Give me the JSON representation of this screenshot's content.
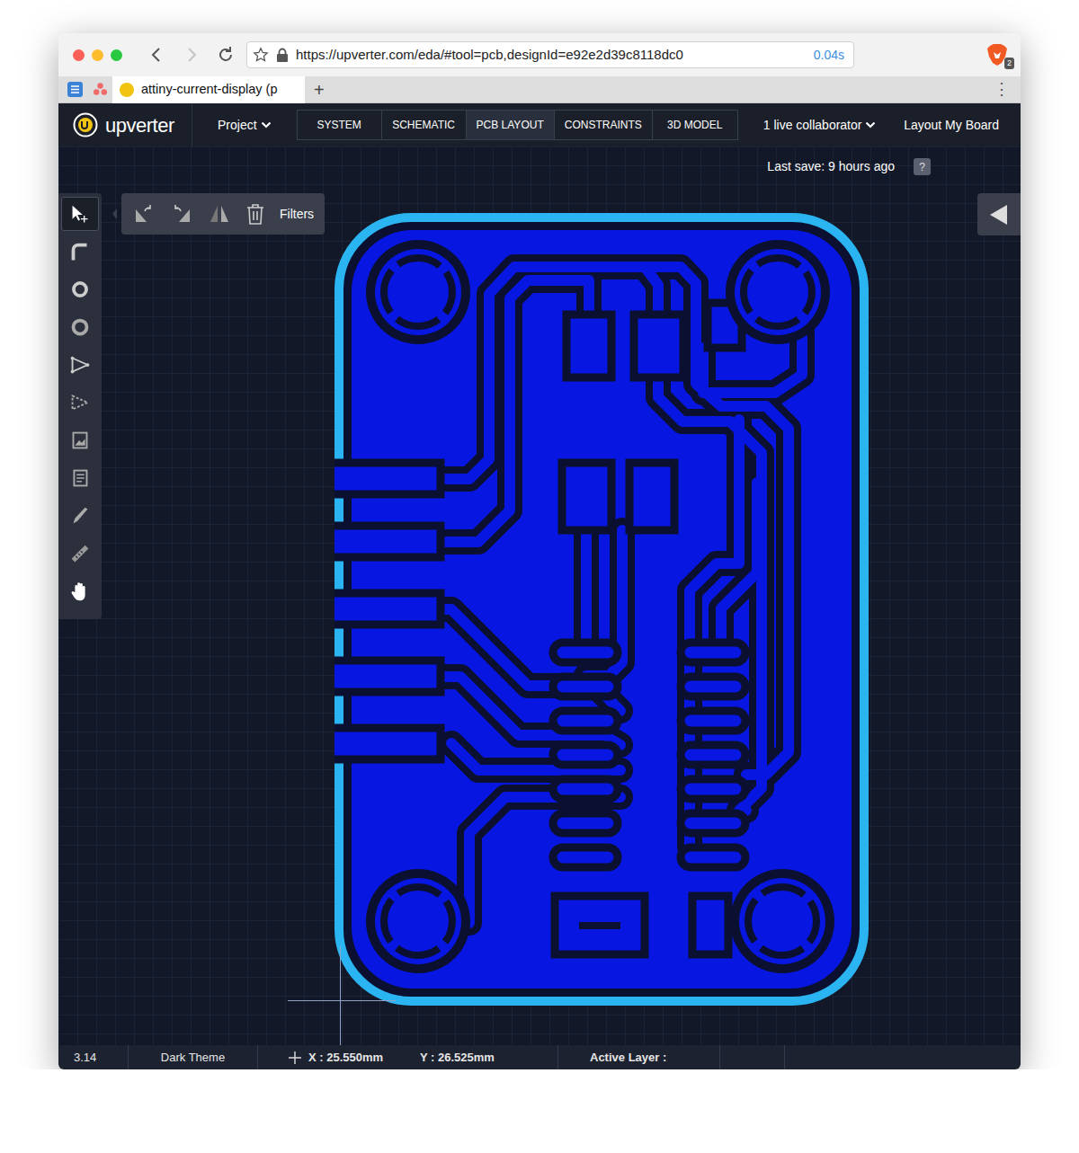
{
  "browser": {
    "nav_buttons": [
      {
        "kind": "back",
        "disabled": false
      },
      {
        "kind": "forward",
        "disabled": true
      },
      {
        "kind": "reload",
        "disabled": false
      }
    ],
    "address_bar": {
      "url": "https://upverter.com/eda/#tool=pcb,designId=e92e2d39c8118dc0",
      "load_time": "0.04s"
    },
    "extension_badge": "2",
    "tabs": [
      {
        "label": "attiny-current-display (p",
        "selected": true
      }
    ],
    "new_tab": "+",
    "menu": "⋮"
  },
  "app": {
    "logo": "upverter",
    "project_menu": "Project",
    "views": [
      {
        "label": "SYSTEM",
        "selected": false
      },
      {
        "label": "SCHEMATIC",
        "selected": false
      },
      {
        "label": "PCB LAYOUT",
        "selected": true
      },
      {
        "label": "CONSTRAINTS",
        "selected": false
      },
      {
        "label": "3D MODEL",
        "selected": false
      }
    ],
    "collaborators": "1 live collaborator",
    "layout_button": "Layout My Board"
  },
  "canvas": {
    "last_save": "Last save: 9 hours ago",
    "help": "?",
    "tools": [
      {
        "kind": "select",
        "selected": true
      },
      {
        "kind": "route",
        "selected": false
      },
      {
        "kind": "via",
        "selected": false
      },
      {
        "kind": "hole",
        "selected": false
      },
      {
        "kind": "polygon",
        "selected": false
      },
      {
        "kind": "cutout",
        "selected": false
      },
      {
        "kind": "image",
        "selected": false
      },
      {
        "kind": "text",
        "selected": false
      },
      {
        "kind": "knife",
        "selected": false
      },
      {
        "kind": "measure",
        "selected": false
      },
      {
        "kind": "pan",
        "selected": false
      }
    ],
    "filters": "Filters"
  },
  "status_bar": {
    "zoom": "3.14",
    "theme": "Dark Theme",
    "x": "X : 25.550mm",
    "y": "Y : 26.525mm",
    "active_layer": "Active Layer :"
  }
}
